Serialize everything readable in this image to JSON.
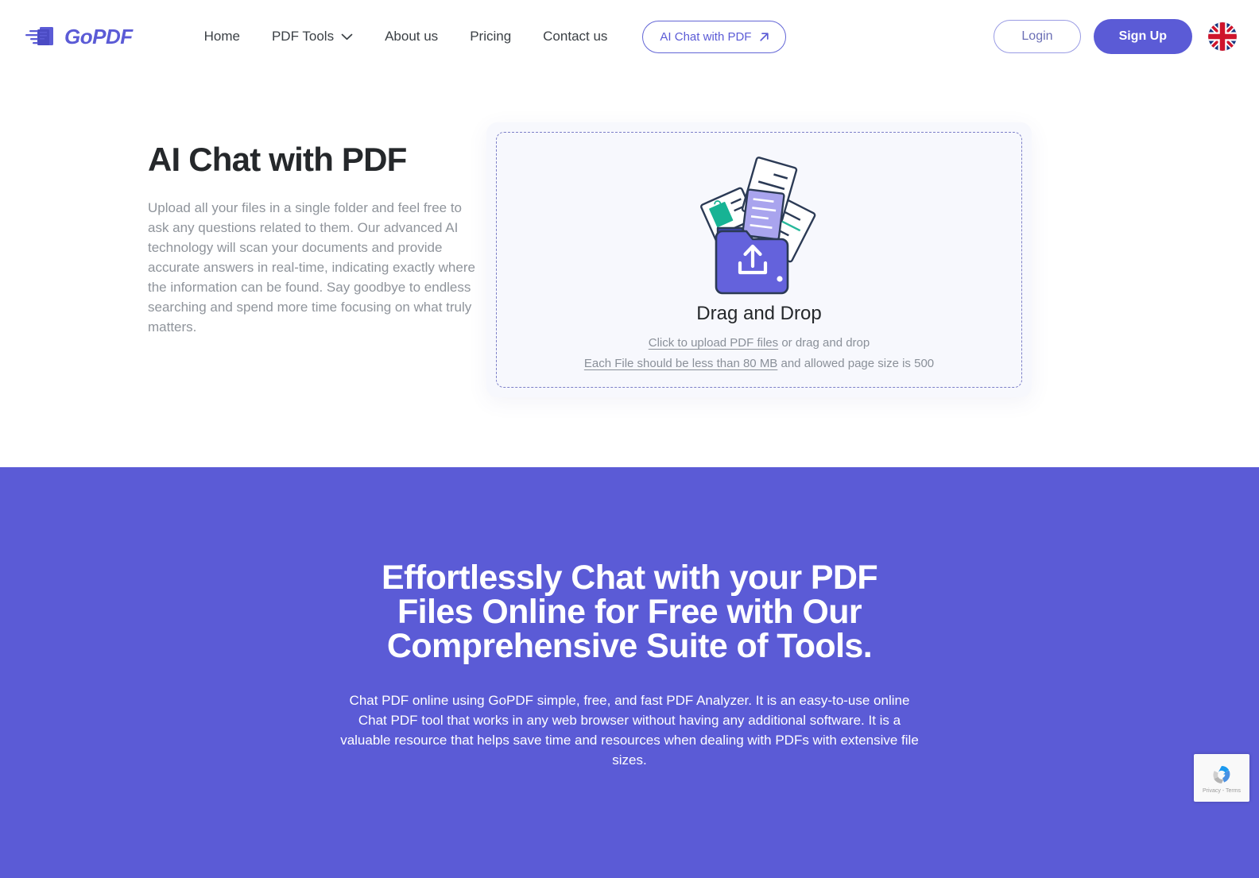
{
  "brand": {
    "name": "GoPDF",
    "accent": "#5b5bd6",
    "logo_icon": "gopdf-logo-icon"
  },
  "header": {
    "nav": [
      {
        "label": "Home",
        "icon": null
      },
      {
        "label": "PDF Tools",
        "icon": "chevron-down-icon"
      },
      {
        "label": "About us",
        "icon": null
      },
      {
        "label": "Pricing",
        "icon": null
      },
      {
        "label": "Contact us",
        "icon": null
      }
    ],
    "ai_chat_button": {
      "label": "AI Chat with PDF",
      "icon": "arrow-up-right-icon"
    },
    "login_label": "Login",
    "signup_label": "Sign Up",
    "language_flag": "uk-flag-icon"
  },
  "hero": {
    "title": "AI Chat with PDF",
    "description": "Upload all your files in a single folder and feel free to ask any questions related to them. Our advanced AI technology will scan your documents and provide accurate answers in real-time, indicating exactly where the information can be found. Say goodbye to endless searching and spend more time focusing on what truly matters."
  },
  "dropzone": {
    "illustration": "folder-upload-illustration",
    "title": "Drag and Drop",
    "upload_link": "Click to upload PDF files",
    "upload_rest": " or drag and drop",
    "limit_link": "Each File should be less than 80 MB",
    "limit_rest": " and allowed page size is 500"
  },
  "promo": {
    "background": "#5b5bd6",
    "title": "Effortlessly Chat with your PDF Files Online for Free with Our Comprehensive Suite of Tools.",
    "description": "Chat PDF online using GoPDF simple, free, and fast PDF Analyzer. It is an easy-to-use online Chat PDF tool that works in any web browser without having any additional software. It is a valuable resource that helps save time and resources when dealing with PDFs with extensive file sizes."
  },
  "recaptcha": {
    "icon": "recaptcha-logo-icon",
    "text": "Privacy - Terms"
  }
}
